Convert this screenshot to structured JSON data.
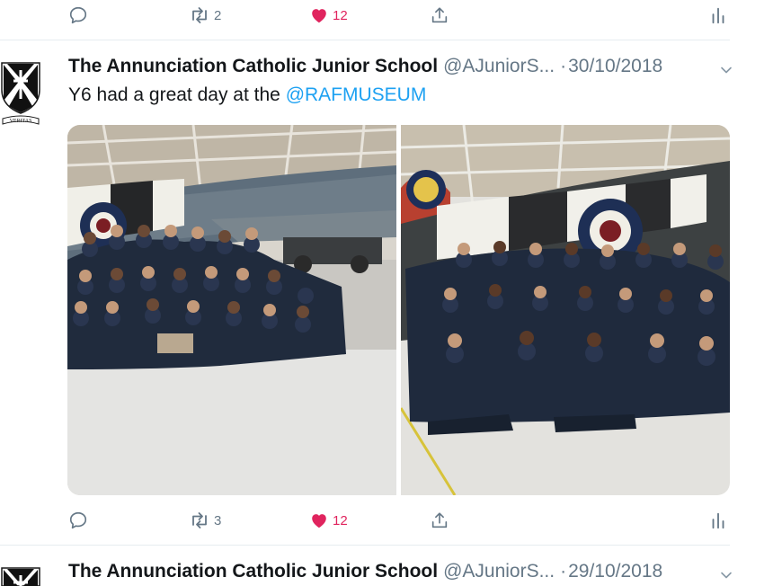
{
  "top_actions": {
    "retweets": "2",
    "likes": "12"
  },
  "tweet": {
    "author": "The Annunciation Catholic Junior School",
    "handle": "@AJuniorS...",
    "separator": "·",
    "date": "30/10/2018",
    "text_prefix": "Y6 had a great day at the ",
    "mention": "@RAFMUSEUM",
    "avatar_motto": "VERITAS",
    "actions": {
      "retweets": "3",
      "likes": "12"
    }
  },
  "next_tweet": {
    "author": "The Annunciation Catholic Junior School",
    "handle": "@AJuniorS...",
    "separator": "·",
    "date": "29/10/2018"
  },
  "colors": {
    "like": "#e0245e",
    "link": "#1da1f2",
    "muted": "#657786",
    "divider": "#e6ecf0"
  },
  "icons": [
    "reply-icon",
    "retweet-icon",
    "like-icon",
    "share-icon",
    "analytics-icon",
    "chevron-down-icon"
  ]
}
